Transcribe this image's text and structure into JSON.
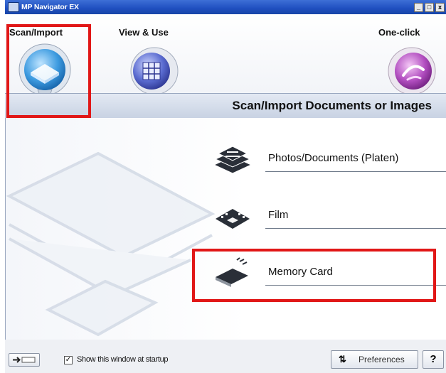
{
  "window": {
    "title": "MP Navigator EX",
    "minimize": "_",
    "maximize": "□",
    "close": "x"
  },
  "modes": [
    {
      "label": "Scan/Import",
      "icon": "scanner-icon",
      "selected": true
    },
    {
      "label": "View & Use",
      "icon": "grid-icon"
    },
    {
      "label": "One-click",
      "icon": "one-click-icon"
    }
  ],
  "header": {
    "title": "Scan/Import Documents or Images"
  },
  "menu": [
    {
      "label": "Photos/Documents (Platen)",
      "icon": "documents-icon"
    },
    {
      "label": "Film",
      "icon": "film-icon"
    },
    {
      "label": "Memory Card",
      "icon": "memory-card-icon"
    }
  ],
  "bottom": {
    "show_at_startup_label": "Show this window at startup",
    "show_at_startup_checked": true,
    "checkbox_mark": "✓",
    "preferences_label": "Preferences",
    "help_label": "?"
  },
  "colors": {
    "highlight": "#e11717",
    "accent": "#1f4fbf"
  }
}
